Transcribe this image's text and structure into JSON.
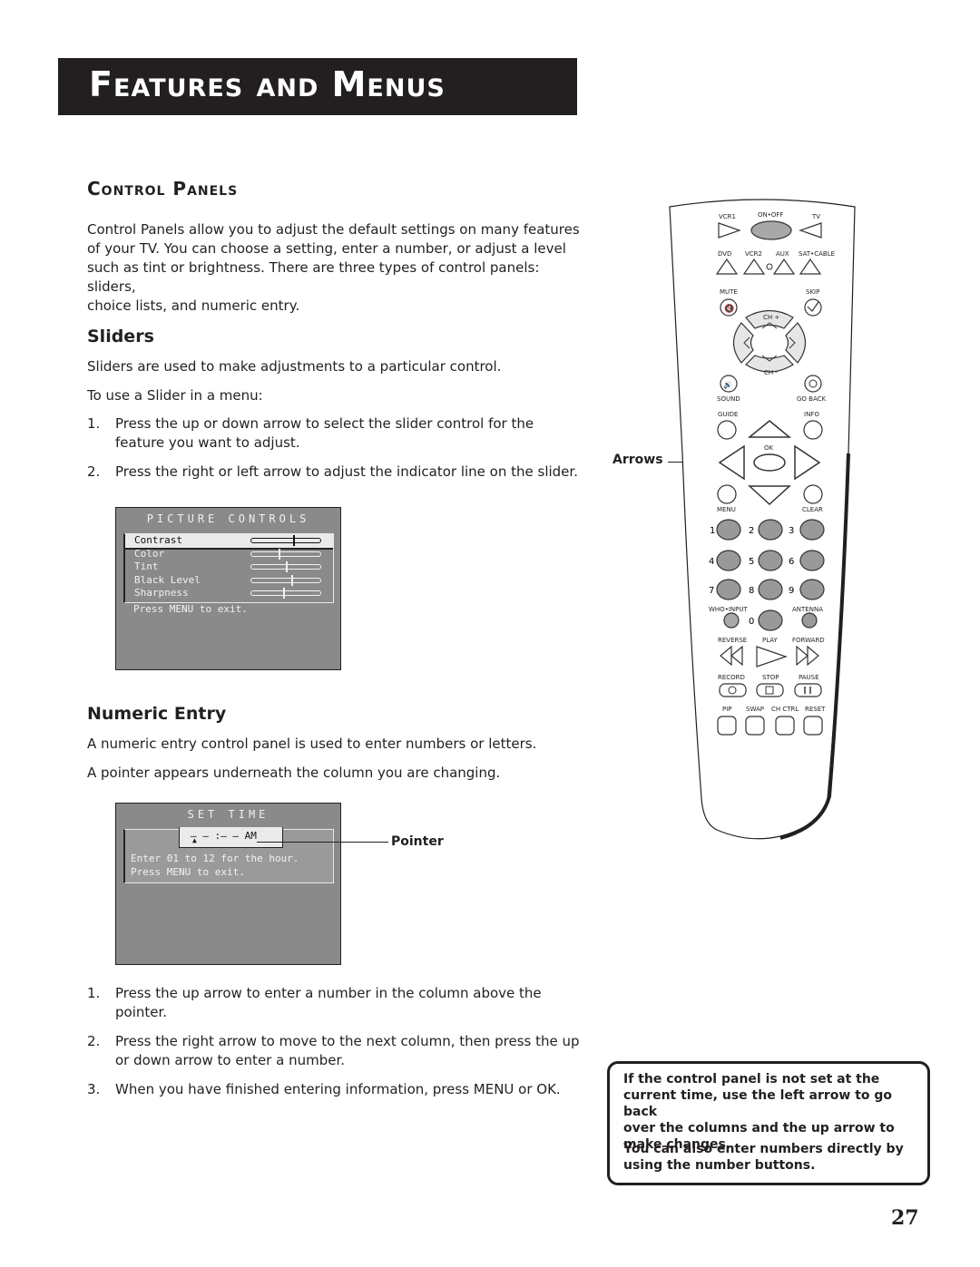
{
  "header": {
    "title": "Features and Menus"
  },
  "section": {
    "title": "Control Panels",
    "intro": [
      "Control Panels allow you to adjust the default settings on many features",
      "of your TV. You can choose a setting, enter a number, or adjust a level",
      "such as tint or brightness. There are three types of control panels: sliders,",
      "choice lists, and numeric entry."
    ]
  },
  "sliders": {
    "heading": "Sliders",
    "desc": "Sliders are used to make adjustments to a particular control.",
    "howto": "To use a Slider in a menu:",
    "steps": [
      {
        "num": "1.",
        "lines": [
          "Press the up or down arrow to select the slider control for the",
          "feature you want to adjust."
        ]
      },
      {
        "num": "2.",
        "lines": [
          "Press the right or left arrow to adjust the indicator line on the slider."
        ]
      }
    ],
    "screen": {
      "title": "PICTURE CONTROLS",
      "items": [
        {
          "label": "Contrast",
          "level": 0.6,
          "selected": true
        },
        {
          "label": "Color",
          "level": 0.4,
          "selected": false
        },
        {
          "label": "Tint",
          "level": 0.5,
          "selected": false
        },
        {
          "label": "Black Level",
          "level": 0.58,
          "selected": false
        },
        {
          "label": "Sharpness",
          "level": 0.46,
          "selected": false
        }
      ],
      "footer": "Press MENU to exit."
    }
  },
  "numeric": {
    "heading": "Numeric Entry",
    "desc1": "A numeric entry control panel is used to enter numbers or letters.",
    "desc2": "A pointer appears underneath the column you are changing.",
    "screen": {
      "title": "SET TIME",
      "time_value": "— — :— — AM",
      "pointer_glyph": "▲",
      "hint1": "Enter 01 to 12 for the hour.",
      "hint2": "Press MENU to exit."
    },
    "pointer_callout": "Pointer",
    "steps": [
      {
        "num": "1.",
        "lines": [
          "Press the up arrow to enter a number in the column above the",
          "pointer."
        ]
      },
      {
        "num": "2.",
        "lines": [
          "Press the right arrow to move to the next column, then press the up",
          "or down arrow to enter a number."
        ]
      },
      {
        "num": "3.",
        "lines": [
          "When you have finished entering information, press MENU or OK."
        ]
      }
    ]
  },
  "remote": {
    "arrows_callout": "Arrows",
    "labels": {
      "vcr1": "VCR1",
      "onoff": "ON•OFF",
      "tv": "TV",
      "dvd": "DVD",
      "vcr2": "VCR2",
      "aux": "AUX",
      "satcable": "SAT•CABLE",
      "mute": "MUTE",
      "skip": "SKIP",
      "chplus": "CH +",
      "chminus": "CH -",
      "vol": "VOL",
      "sound": "SOUND",
      "goback": "GO  BACK",
      "guide": "GUIDE",
      "info": "INFO",
      "ok": "OK",
      "menu": "MENU",
      "clear": "CLEAR",
      "whoinput": "WHO•INPUT",
      "antenna": "ANTENNA",
      "reverse": "REVERSE",
      "play": "PLAY",
      "forward": "FORWARD",
      "record": "RECORD",
      "stop": "STOP",
      "pause": "PAUSE",
      "pip": "PIP",
      "swap": "SWAP",
      "chctrl": "CH CTRL",
      "reset": "RESET"
    },
    "digits": [
      "1",
      "2",
      "3",
      "4",
      "5",
      "6",
      "7",
      "8",
      "9",
      "0"
    ]
  },
  "note": {
    "p1": [
      "If the control panel is not set at the",
      "current time, use the left arrow to go back",
      "over the columns and the up arrow to",
      "make changes."
    ],
    "p2": [
      "You can also enter numbers directly by",
      "using the number buttons."
    ]
  },
  "page_number": "27"
}
